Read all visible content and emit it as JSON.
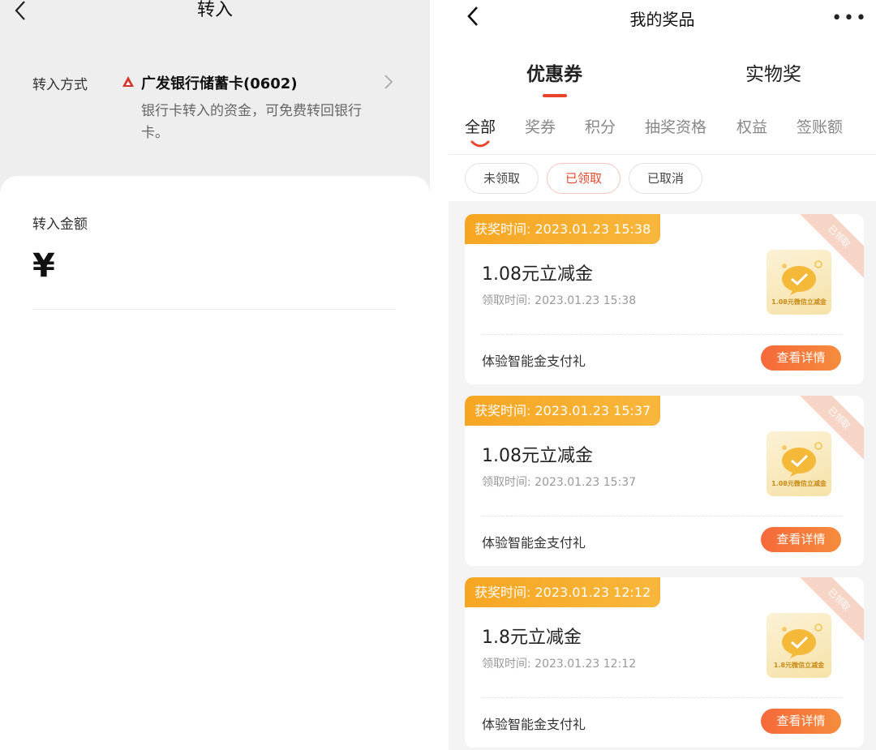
{
  "left": {
    "title": "转入",
    "method_label": "转入方式",
    "bank_name": "广发银行储蓄卡(0602)",
    "bank_desc": "银行卡转入的资金，可免费转回银行卡。",
    "amount_label": "转入金额",
    "currency_symbol": "¥",
    "accent_color": "#d2362a"
  },
  "right": {
    "title": "我的奖品",
    "more_label": "•••",
    "main_tabs": [
      {
        "label": "优惠券",
        "active": true
      },
      {
        "label": "实物奖",
        "active": false
      }
    ],
    "sub_tabs": [
      {
        "label": "全部",
        "active": true
      },
      {
        "label": "奖券"
      },
      {
        "label": "积分"
      },
      {
        "label": "抽奖资格"
      },
      {
        "label": "权益"
      },
      {
        "label": "签账额"
      }
    ],
    "filters": [
      {
        "label": "未领取"
      },
      {
        "label": "已领取",
        "active": true
      },
      {
        "label": "已取消"
      }
    ],
    "coupons": [
      {
        "award_time": "获奖时间: 2023.01.23 15:38",
        "title": "1.08元立减金",
        "claim_time": "领取时间: 2023.01.23 15:38",
        "thumb_text": "1.08元微信立减金",
        "footer": "体验智能金支付礼",
        "button": "查看详情",
        "ribbon": "已领取"
      },
      {
        "award_time": "获奖时间: 2023.01.23 15:37",
        "title": "1.08元立减金",
        "claim_time": "领取时间: 2023.01.23 15:37",
        "thumb_text": "1.08元微信立减金",
        "footer": "体验智能金支付礼",
        "button": "查看详情",
        "ribbon": "已领取"
      },
      {
        "award_time": "获奖时间: 2023.01.23 12:12",
        "title": "1.8元立减金",
        "claim_time": "领取时间: 2023.01.23 12:12",
        "thumb_text": "1.8元微信立减金",
        "footer": "体验智能金支付礼",
        "button": "查看详情",
        "ribbon": "已领取"
      }
    ],
    "accent_color": "#e8442c",
    "tag_color": "#f6a623",
    "button_color": "#f6693a"
  }
}
